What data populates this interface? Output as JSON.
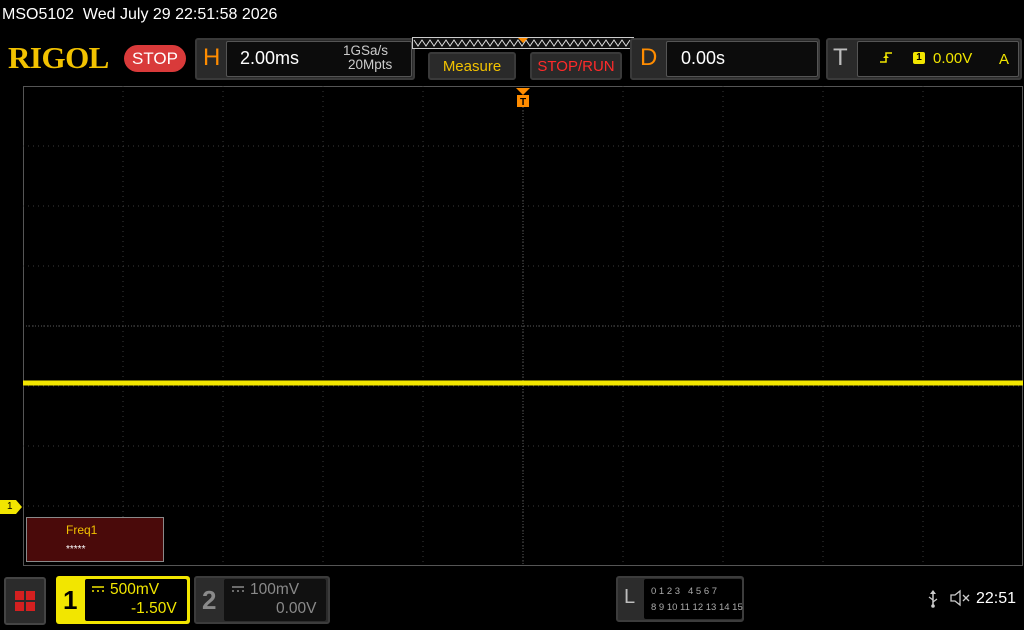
{
  "title_bar": {
    "text": "MSO5102  Wed July 29 22:51:58 2026"
  },
  "header": {
    "logo": "RIGOL",
    "status_badge": "STOP",
    "horizontal": {
      "letter": "H",
      "timebase": "2.00ms",
      "sample_rate": "1GSa/s",
      "memory_depth": "20Mpts"
    },
    "measure_button": "Measure",
    "stop_run_button": "STOP/RUN",
    "delay": {
      "letter": "D",
      "value": "0.00s"
    },
    "trigger": {
      "letter": "T",
      "edge_icon": "rising-edge-icon",
      "source": "1",
      "level": "0.00V",
      "mode": "A"
    }
  },
  "screen": {
    "grid_divisions": {
      "x": 10,
      "y": 8
    },
    "trace": {
      "channel": "1",
      "color": "#f2e600",
      "level_div_from_top": 4.95
    },
    "ch1_ground_marker": "1",
    "measurement": {
      "label": "Freq1",
      "value": "*****"
    }
  },
  "bottom": {
    "ch1": {
      "number": "1",
      "coupling_icon": "dc-coupling-icon",
      "scale": "500mV",
      "offset": "-1.50V"
    },
    "ch2": {
      "number": "2",
      "coupling_icon": "dc-coupling-icon",
      "scale": "100mV",
      "offset": "0.00V"
    },
    "logic": {
      "letter": "L",
      "row1": "0 1 2 3   4 5 6 7",
      "row2": "8 9 10 11 12 13 14 15"
    },
    "usb_icon": "usb-icon",
    "speaker_icon": "speaker-muted-icon",
    "clock": "22:51"
  },
  "colors": {
    "ch1": "#f2e600",
    "accent_orange": "#ff8c00",
    "stop_red": "#d93a3a",
    "logo_yellow": "#f2c200"
  }
}
